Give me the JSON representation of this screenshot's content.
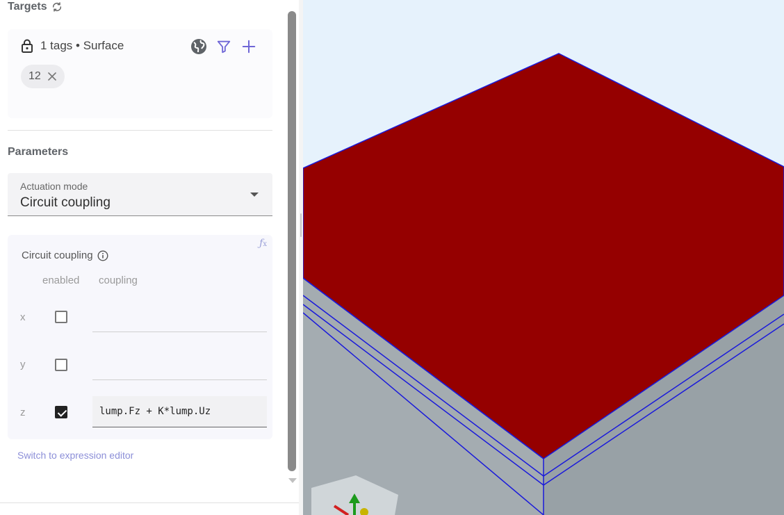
{
  "targets": {
    "title": "Targets",
    "summary": "1 tags • Surface",
    "chip_label": "12"
  },
  "parameters": {
    "title": "Parameters",
    "actuation_mode": {
      "label": "Actuation mode",
      "value": "Circuit coupling"
    }
  },
  "circuit_coupling": {
    "title": "Circuit coupling",
    "column_headers": [
      "enabled",
      "coupling"
    ],
    "rows": [
      {
        "label": "x",
        "enabled": false,
        "coupling": ""
      },
      {
        "label": "y",
        "enabled": false,
        "coupling": ""
      },
      {
        "label": "z",
        "enabled": true,
        "coupling": "lump.Fz + K*lump.Uz"
      }
    ],
    "switch_link": "Switch to expression editor"
  },
  "viewport": {
    "top_face_color": "#950000",
    "side_color": "#9aa3a8",
    "edge_color": "#1a1adb",
    "background": "#e6f2fc"
  }
}
